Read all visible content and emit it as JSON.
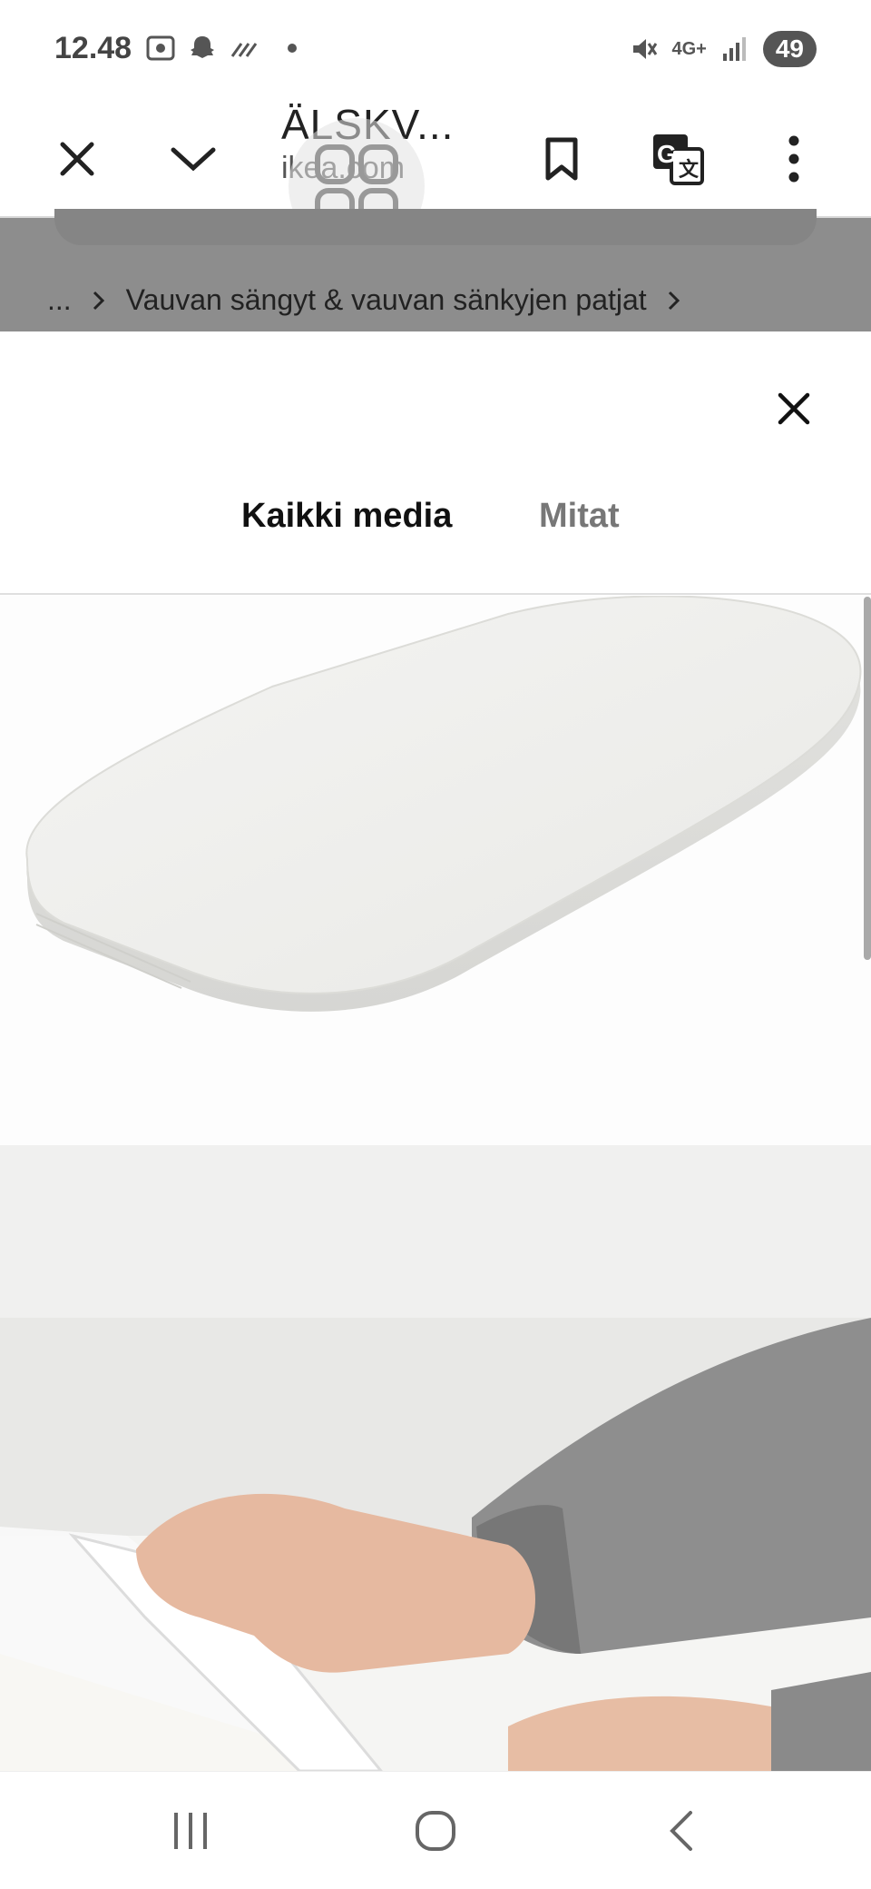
{
  "status_bar": {
    "time": "12.48",
    "network": "4G+",
    "battery": "49"
  },
  "toolbar": {
    "title": "ÄLSKV...",
    "domain": "ikea.com"
  },
  "breadcrumb": {
    "ellipsis": "...",
    "item": "Vauvan sängyt & vauvan sänkyjen patjat"
  },
  "media_sheet": {
    "tabs": [
      {
        "label": "Kaikki media",
        "active": true
      },
      {
        "label": "Mitat",
        "active": false
      }
    ]
  },
  "colors": {
    "accent": "#0058a3",
    "dim_overlay": "#8d8d8d"
  },
  "icons": [
    "close-icon",
    "chevron-down-icon",
    "bookmark-icon",
    "translate-icon",
    "more-vert-icon",
    "breadcrumb-chevron-icon",
    "recent-apps-icon",
    "home-icon",
    "back-icon"
  ]
}
